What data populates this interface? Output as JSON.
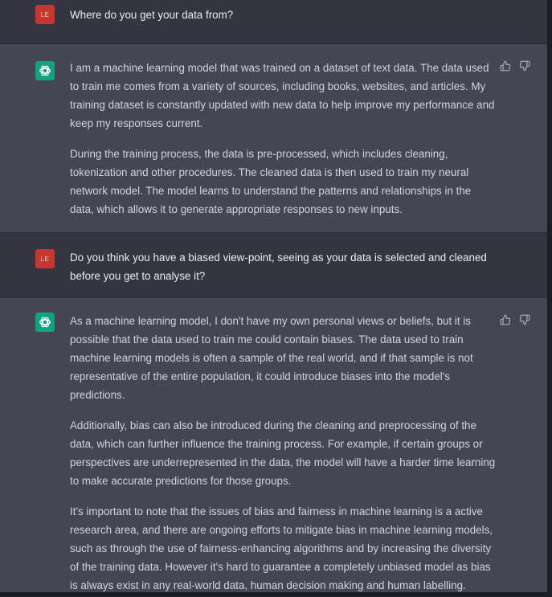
{
  "messages": [
    {
      "role": "user",
      "avatar_label": "LE",
      "text": "Where do you get your data from?"
    },
    {
      "role": "assistant",
      "avatar_icon": "openai-logo-icon",
      "paragraphs": [
        "I am a machine learning model that was trained on a dataset of text data. The data used to train me comes from a variety of sources, including books, websites, and articles. My training dataset is constantly updated with new data to help improve my performance and keep my responses current.",
        "During the training process, the data is pre-processed, which includes cleaning, tokenization and other procedures. The cleaned data is then used to train my neural network model. The model learns to understand the patterns and relationships in the data, which allows it to generate appropriate responses to new inputs."
      ]
    },
    {
      "role": "user",
      "avatar_label": "LE",
      "text": "Do you think you have a biased view-point, seeing as your data is selected and cleaned before you get to analyse it?"
    },
    {
      "role": "assistant",
      "avatar_icon": "openai-logo-icon",
      "paragraphs": [
        "As a machine learning model, I don't have my own personal views or beliefs, but it is possible that the data used to train me could contain biases. The data used to train machine learning models is often a sample of the real world, and if that sample is not representative of the entire population, it could introduce biases into the model's predictions.",
        "Additionally, bias can also be introduced during the cleaning and preprocessing of the data, which can further influence the training process. For example, if certain groups or perspectives are underrepresented in the data, the model will have a harder time learning to make accurate predictions for those groups.",
        "It's important to note that the issues of bias and fairness in machine learning is a active research area, and there are ongoing efforts to mitigate bias in machine learning models, such as through the use of fairness-enhancing algorithms and by increasing the diversity of the training data. However it's hard to guarantee a completely unbiased model as bias is always exist in any real-world data, human decision making and human labelling."
      ]
    }
  ],
  "colors": {
    "user_bg": "#343541",
    "assistant_bg": "#444654",
    "user_avatar": "#c6372d",
    "bot_avatar": "#10a37f",
    "text": "#d1d5db"
  }
}
